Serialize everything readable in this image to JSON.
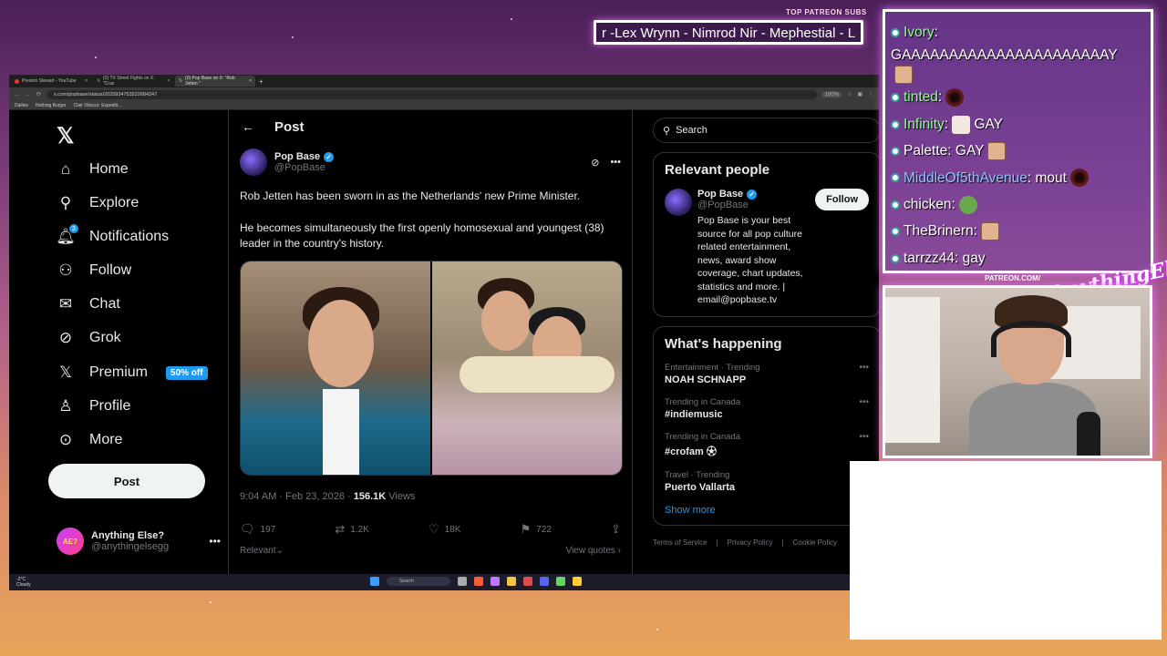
{
  "overlay": {
    "patreon_label": "TOP PATREON SUBS",
    "patreon_scroll": "r -Lex Wrynn - Nimrod Nir - Mephestial - L",
    "patreon_tag": "PATREON.COM/",
    "channel_logo": "AnythingElse"
  },
  "browser": {
    "tabs": [
      {
        "label": "Preston Stewart - YouTube"
      },
      {
        "label": "(0) TX Street Fights on X: \"Craz"
      },
      {
        "label": "(0) Pop Base on X: \"Rob Jetten \""
      }
    ],
    "url": "x.com/popbase/status/2025934753522684247",
    "zoom": "100%",
    "bookmarks": [
      "Dailies",
      "Nothing Burger",
      "Clair Obscur: Expediti..."
    ]
  },
  "nav": {
    "items": [
      {
        "label": "Home",
        "icon": "home-icon"
      },
      {
        "label": "Explore",
        "icon": "search-icon"
      },
      {
        "label": "Notifications",
        "icon": "bell-icon",
        "badge": "3"
      },
      {
        "label": "Follow",
        "icon": "follow-icon"
      },
      {
        "label": "Chat",
        "icon": "mail-icon"
      },
      {
        "label": "Grok",
        "icon": "grok-icon"
      },
      {
        "label": "Premium",
        "icon": "x-icon",
        "promo": "50% off"
      },
      {
        "label": "Profile",
        "icon": "person-icon"
      },
      {
        "label": "More",
        "icon": "more-icon"
      }
    ],
    "post_button": "Post",
    "account": {
      "name": "Anything Else?",
      "handle": "@anythingelsegg",
      "avatar_text": "AE?"
    }
  },
  "post": {
    "header": "Post",
    "author_name": "Pop Base",
    "author_handle": "@PopBase",
    "text_1": "Rob Jetten has been sworn in as the Netherlands' new Prime Minister.",
    "text_2": "He becomes simultaneously the first openly homosexual and youngest (38) leader in the country's history.",
    "timestamp": "9:04 AM · Feb 23, 2026 · ",
    "views_count": "156.1K",
    "views_label": " Views",
    "actions": {
      "replies": "197",
      "reposts": "1.2K",
      "likes": "18K",
      "bookmarks": "722"
    },
    "sort_label": "Relevant",
    "view_quotes": "View quotes"
  },
  "sidebar": {
    "search_placeholder": "Search",
    "relevant_title": "Relevant people",
    "relevant_name": "Pop Base",
    "relevant_handle": "@PopBase",
    "follow_label": "Follow",
    "relevant_bio": "Pop Base is your best source for all pop culture related entertainment, news, award show coverage, chart updates, statistics and more. | email@popbase.tv",
    "happening_title": "What's happening",
    "trends": [
      {
        "context": "Entertainment · Trending",
        "title": "NOAH SCHNAPP"
      },
      {
        "context": "Trending in Canada",
        "title": "#indiemusic"
      },
      {
        "context": "Trending in Canada",
        "title": "#crofam"
      },
      {
        "context": "Travel · Trending",
        "title": "Puerto Vallarta"
      }
    ],
    "show_more": "Show more",
    "footer_links": [
      "Terms of Service",
      "Privacy Policy",
      "Cookie Policy"
    ]
  },
  "taskbar": {
    "weather_temp": "-2°C",
    "weather_desc": "Cloudy",
    "search_label": "Search"
  },
  "chat": {
    "messages": [
      {
        "user": "Ivory",
        "text": "GAAAAAAAAAAAAAAAAAAAAAAY",
        "user_color": "#8cff8c"
      },
      {
        "user": "tinted",
        "text": "",
        "user_color": "#8cff8c"
      },
      {
        "user": "Infinity",
        "text": "GAY",
        "user_color": "#8cff8c"
      },
      {
        "user": "Palette",
        "text": "GAY",
        "user_color": "#ffffff"
      },
      {
        "user": "MiddleOf5thAvenue",
        "text": "mout",
        "user_color": "#8ec5ff"
      },
      {
        "user": "chicken",
        "text": "",
        "user_color": "#ffffff"
      },
      {
        "user": "TheBrinern",
        "text": "",
        "user_color": "#ffffff"
      },
      {
        "user": "tarrzz44",
        "text": "gay",
        "user_color": "#ffffff"
      }
    ]
  }
}
